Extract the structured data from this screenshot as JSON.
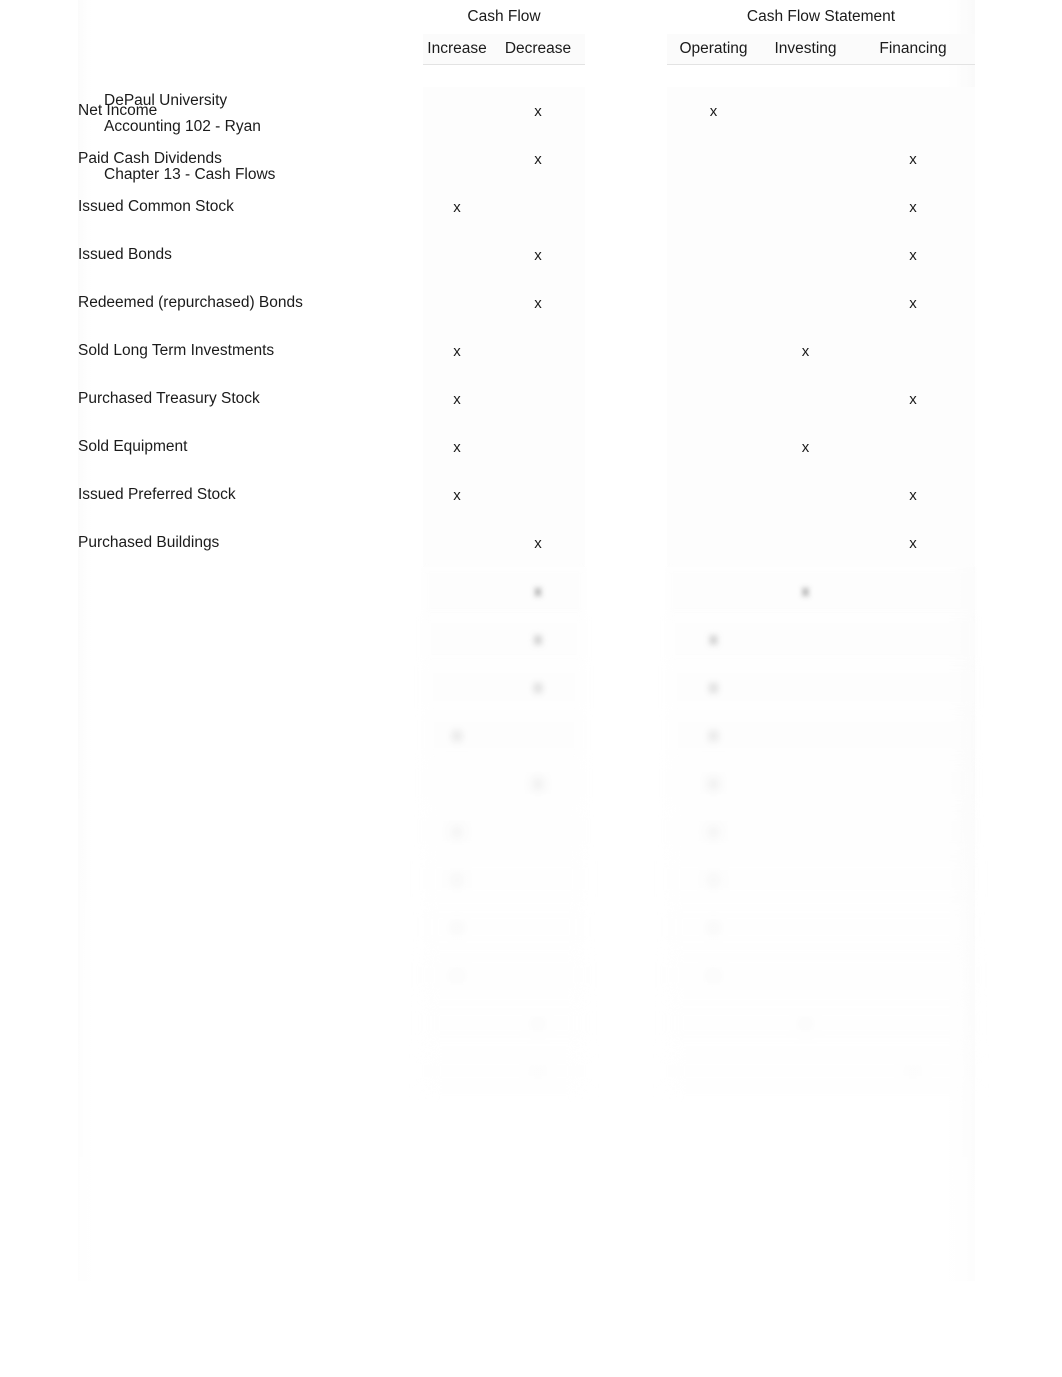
{
  "document": {
    "institution": "DePaul University",
    "course": "Accounting 102 - Ryan",
    "chapter": "Chapter 13 - Cash Flows"
  },
  "table": {
    "group_headers": {
      "cash_flow": "Cash Flow",
      "cash_flow_statement": "Cash Flow Statement"
    },
    "columns": {
      "transaction": "",
      "increase": "Increase",
      "decrease": "Decrease",
      "operating": "Operating",
      "investing": "Investing",
      "financing": "Financing"
    },
    "mark": "x",
    "rows": [
      {
        "label": "Net Income",
        "increase": "",
        "decrease": "x",
        "operating": "x",
        "investing": "",
        "financing": "",
        "legible": true
      },
      {
        "label": "Paid Cash Dividends",
        "increase": "",
        "decrease": "x",
        "operating": "",
        "investing": "",
        "financing": "x",
        "legible": true
      },
      {
        "label": "Issued Common Stock",
        "increase": "x",
        "decrease": "",
        "operating": "",
        "investing": "",
        "financing": "x",
        "legible": true
      },
      {
        "label": "Issued Bonds",
        "increase": "",
        "decrease": "x",
        "operating": "",
        "investing": "",
        "financing": "x",
        "legible": true
      },
      {
        "label": "Redeemed (repurchased) Bonds",
        "increase": "",
        "decrease": "x",
        "operating": "",
        "investing": "",
        "financing": "x",
        "legible": true
      },
      {
        "label": "Sold Long Term Investments",
        "increase": "x",
        "decrease": "",
        "operating": "",
        "investing": "x",
        "financing": "",
        "legible": true
      },
      {
        "label": "Purchased Treasury Stock",
        "increase": "x",
        "decrease": "",
        "operating": "",
        "investing": "",
        "financing": "x",
        "legible": true
      },
      {
        "label": "Sold Equipment",
        "increase": "x",
        "decrease": "",
        "operating": "",
        "investing": "x",
        "financing": "",
        "legible": true
      },
      {
        "label": "Issued Preferred Stock",
        "increase": "x",
        "decrease": "",
        "operating": "",
        "investing": "",
        "financing": "x",
        "legible": true
      },
      {
        "label": "Purchased Buildings",
        "increase": "",
        "decrease": "x",
        "operating": "",
        "investing": "",
        "financing": "x",
        "legible": true
      },
      {
        "label": "",
        "increase": "",
        "decrease": "x",
        "operating": "",
        "investing": "x",
        "financing": "",
        "legible": false
      },
      {
        "label": "",
        "increase": "",
        "decrease": "x",
        "operating": "x",
        "investing": "",
        "financing": "",
        "legible": false
      },
      {
        "label": "",
        "increase": "",
        "decrease": "x",
        "operating": "x",
        "investing": "",
        "financing": "",
        "legible": false
      },
      {
        "label": "",
        "increase": "x",
        "decrease": "",
        "operating": "x",
        "investing": "",
        "financing": "",
        "legible": false
      },
      {
        "label": "",
        "increase": "",
        "decrease": "x",
        "operating": "x",
        "investing": "",
        "financing": "",
        "legible": false
      },
      {
        "label": "",
        "increase": "x",
        "decrease": "",
        "operating": "x",
        "investing": "",
        "financing": "",
        "legible": false
      },
      {
        "label": "",
        "increase": "x",
        "decrease": "",
        "operating": "x",
        "investing": "",
        "financing": "",
        "legible": false
      },
      {
        "label": "",
        "increase": "x",
        "decrease": "",
        "operating": "x",
        "investing": "",
        "financing": "",
        "legible": false
      },
      {
        "label": "",
        "increase": "x",
        "decrease": "",
        "operating": "x",
        "investing": "",
        "financing": "",
        "legible": false
      },
      {
        "label": "",
        "increase": "",
        "decrease": "x",
        "operating": "",
        "investing": "x",
        "financing": "",
        "legible": false
      },
      {
        "label": "",
        "increase": "",
        "decrease": "x",
        "operating": "",
        "investing": "",
        "financing": "x",
        "legible": false
      }
    ]
  }
}
